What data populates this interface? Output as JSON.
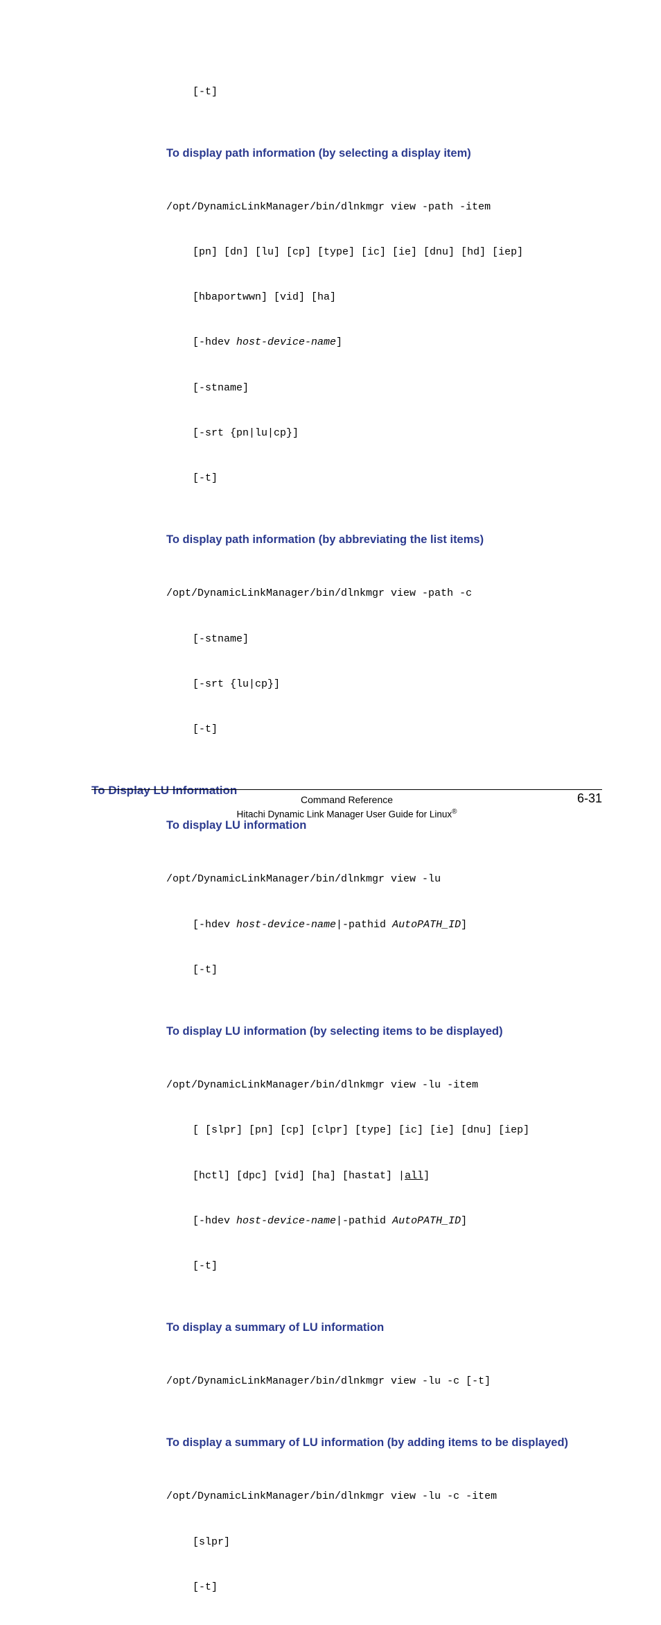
{
  "block0": {
    "line1": "[-t]"
  },
  "section1": {
    "heading": "To display path information (by selecting a display item)",
    "line1": "/opt/DynamicLinkManager/bin/dlnkmgr view -path -item",
    "line2": "[pn] [dn] [lu] [cp] [type] [ic] [ie] [dnu] [hd] [iep]",
    "line3": "[hbaportwwn] [vid] [ha]",
    "line4a": "[-hdev ",
    "line4b": "host-device-name",
    "line4c": "]",
    "line5": "[-stname]",
    "line6": "[-srt {pn|lu|cp}]",
    "line7": "[-t]"
  },
  "section2": {
    "heading": "To display path information (by abbreviating the list items)",
    "line1": "/opt/DynamicLinkManager/bin/dlnkmgr view -path -c",
    "line2": "[-stname]",
    "line3": "[-srt {lu|cp}]",
    "line4": "[-t]"
  },
  "sectionLU": {
    "heading": "To Display LU Information"
  },
  "section3": {
    "heading": "To display LU information",
    "line1": "/opt/DynamicLinkManager/bin/dlnkmgr view -lu",
    "line2a": "[-hdev ",
    "line2b": "host-device-name",
    "line2c": "|-pathid ",
    "line2d": "AutoPATH_ID",
    "line2e": "]",
    "line3": "[-t]"
  },
  "section4": {
    "heading": "To display LU information (by selecting items to be displayed)",
    "line1": "/opt/DynamicLinkManager/bin/dlnkmgr view -lu -item",
    "line2": "[ [slpr] [pn] [cp] [clpr] [type] [ic] [ie] [dnu] [iep]",
    "line3a": "[hctl] [dpc] [vid] [ha] [hastat] |",
    "line3b": "all",
    "line3c": "]",
    "line4a": "[-hdev ",
    "line4b": "host-device-name",
    "line4c": "|-pathid ",
    "line4d": "AutoPATH_ID",
    "line4e": "]",
    "line5": "[-t]"
  },
  "section5": {
    "heading": "To display a summary of LU information",
    "line1": "/opt/DynamicLinkManager/bin/dlnkmgr view -lu -c [-t]"
  },
  "section6": {
    "heading": "To display a summary of LU information (by adding items to be displayed)",
    "line1": "/opt/DynamicLinkManager/bin/dlnkmgr view -lu -c -item",
    "line2": "[slpr]",
    "line3": "[-t]"
  },
  "footer": {
    "chapter": "Command Reference",
    "page": "6-31",
    "guide_a": "Hitachi Dynamic Link Manager User Guide for Linux",
    "guide_b": "®"
  }
}
